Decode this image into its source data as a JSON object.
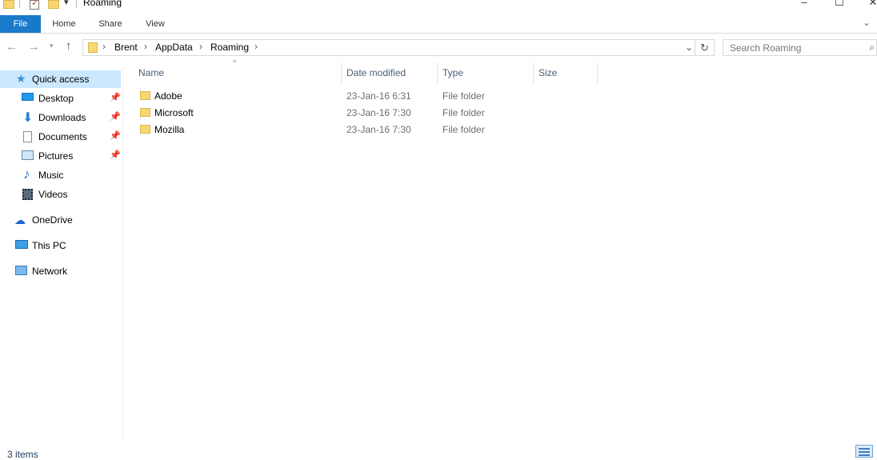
{
  "window": {
    "title": "Roaming",
    "controls": {
      "minimize": "–",
      "maximize": "☐",
      "close": "✕"
    }
  },
  "ribbon": {
    "tabs": [
      "File",
      "Home",
      "Share",
      "View"
    ],
    "expand_icon": "chevron-down-icon"
  },
  "address": {
    "breadcrumbs": [
      "Brent",
      "AppData",
      "Roaming"
    ],
    "separator": "›"
  },
  "search": {
    "placeholder": "Search Roaming"
  },
  "nav": {
    "quick_access": "Quick access",
    "quick_items": [
      {
        "label": "Desktop",
        "icon": "desktop-icon",
        "pinned": true
      },
      {
        "label": "Downloads",
        "icon": "download-icon",
        "pinned": true
      },
      {
        "label": "Documents",
        "icon": "documents-icon",
        "pinned": true
      },
      {
        "label": "Pictures",
        "icon": "pictures-icon",
        "pinned": true
      },
      {
        "label": "Music",
        "icon": "music-icon",
        "pinned": false
      },
      {
        "label": "Videos",
        "icon": "videos-icon",
        "pinned": false
      }
    ],
    "onedrive": "OneDrive",
    "thispc": "This PC",
    "network": "Network"
  },
  "columns": {
    "name": "Name",
    "date": "Date modified",
    "type": "Type",
    "size": "Size"
  },
  "files": [
    {
      "name": "Adobe",
      "date": "23-Jan-16 6:31",
      "type": "File folder"
    },
    {
      "name": "Microsoft",
      "date": "23-Jan-16 7:30",
      "type": "File folder"
    },
    {
      "name": "Mozilla",
      "date": "23-Jan-16 7:30",
      "type": "File folder"
    }
  ],
  "status": {
    "item_count": "3 items"
  },
  "colors": {
    "accent": "#1979ca",
    "selection": "#cce8ff",
    "header_text": "#4c607a"
  }
}
